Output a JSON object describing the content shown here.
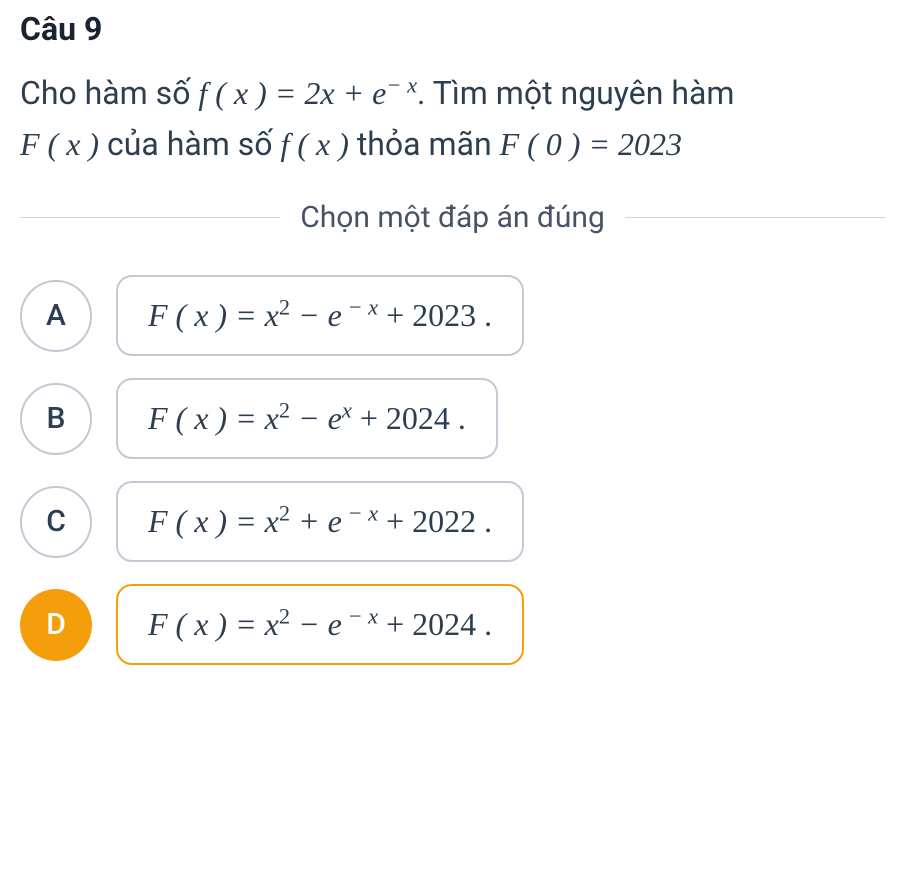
{
  "question": {
    "number": "Câu 9",
    "text_part1": "Cho hàm số ",
    "formula1": "f ( x ) = 2x + e",
    "formula1_exp": "− x",
    "text_part2": ". Tìm một nguyên hàm ",
    "formula2": "F ( x )",
    "text_part3": " của hàm số ",
    "formula3": "f ( x )",
    "text_part4": " thỏa mãn ",
    "formula4": "F ( 0 ) = 2023"
  },
  "instruction": "Chọn một đáp án đúng",
  "options": {
    "A": {
      "letter": "A",
      "selected": false,
      "formula_prefix": "F ( x ) = x",
      "formula_mid_op": " − e",
      "formula_exp2_neg": true,
      "formula_suffix": " + 2023 ."
    },
    "B": {
      "letter": "B",
      "selected": false,
      "formula_prefix": "F ( x ) = x",
      "formula_mid_op": " − e",
      "formula_exp2_neg": false,
      "formula_suffix": " + 2024 ."
    },
    "C": {
      "letter": "C",
      "selected": false,
      "formula_prefix": "F ( x ) = x",
      "formula_mid_op": " + e",
      "formula_exp2_neg": true,
      "formula_suffix": " + 2022 ."
    },
    "D": {
      "letter": "D",
      "selected": true,
      "formula_prefix": "F ( x ) = x",
      "formula_mid_op": " − e",
      "formula_exp2_neg": true,
      "formula_suffix": " + 2024 ."
    }
  }
}
